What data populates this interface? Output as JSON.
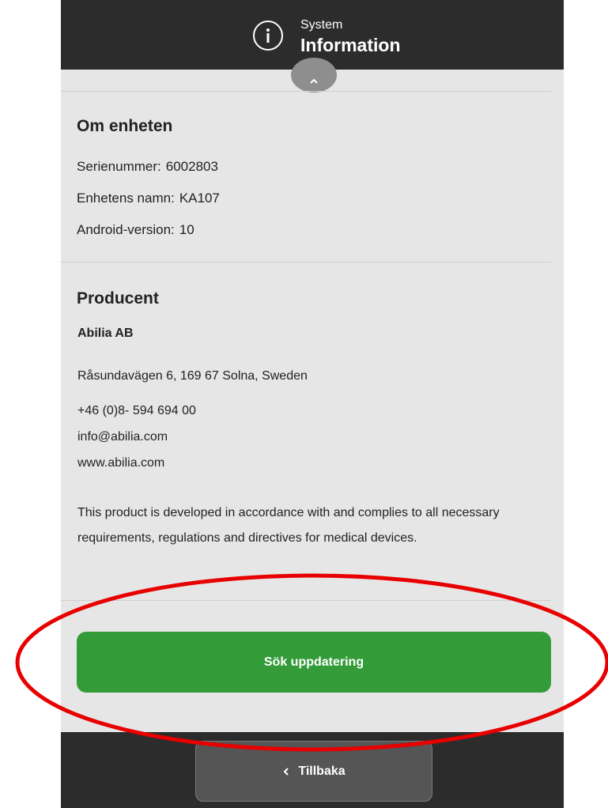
{
  "header": {
    "icon": "info-icon",
    "subtitle": "System",
    "title": "Information"
  },
  "collapse": {
    "icon": "chevron-up-icon"
  },
  "about": {
    "title": "Om enheten",
    "serial_label": "Serienummer:",
    "serial_value": "6002803",
    "name_label": "Enhetens namn:",
    "name_value": "KA107",
    "android_label": "Android-version:",
    "android_value": "10"
  },
  "producer": {
    "title": "Producent",
    "company": "Abilia AB",
    "address": "Råsundavägen 6, 169 67 Solna, Sweden",
    "phone": "+46 (0)8- 594 694 00",
    "email": "info@abilia.com",
    "website": "www.abilia.com",
    "disclaimer": "This product is developed in accordance with and complies to all necessary requirements, regulations and directives for medical devices."
  },
  "actions": {
    "update_label": "Sök uppdatering"
  },
  "footer": {
    "back_label": "Tillbaka",
    "back_icon": "chevron-left-icon"
  },
  "colors": {
    "header_bg": "#2c2c2c",
    "content_bg": "#e6e6e6",
    "update_button": "#339c39",
    "back_button": "#555555",
    "highlight": "#e80000"
  }
}
